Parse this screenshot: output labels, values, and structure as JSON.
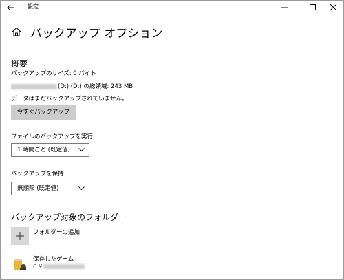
{
  "window": {
    "title": "設定"
  },
  "header": {
    "page_title": "バックアップ オプション"
  },
  "overview": {
    "heading": "概要",
    "backup_size": "バックアップのサイズ: 0 バイト",
    "drive_info": "(D:) (D:) の総領域: 243 MB",
    "status": "データはまだバックアップされていません。",
    "backup_now_label": "今すぐバックアップ"
  },
  "frequency": {
    "label": "ファイルのバックアップを実行",
    "selected": "1 時間ごと (既定値)"
  },
  "retention": {
    "label": "バックアップを保持",
    "selected": "無期限 (既定値)"
  },
  "folders": {
    "heading": "バックアップ対象のフォルダー",
    "add_label": "フォルダーの追加",
    "items": [
      {
        "name": "保存したゲーム",
        "path_prefix": "C:¥"
      }
    ]
  },
  "colors": {
    "button_bg": "#cccccc",
    "folder_yellow": "#e8b43a"
  }
}
